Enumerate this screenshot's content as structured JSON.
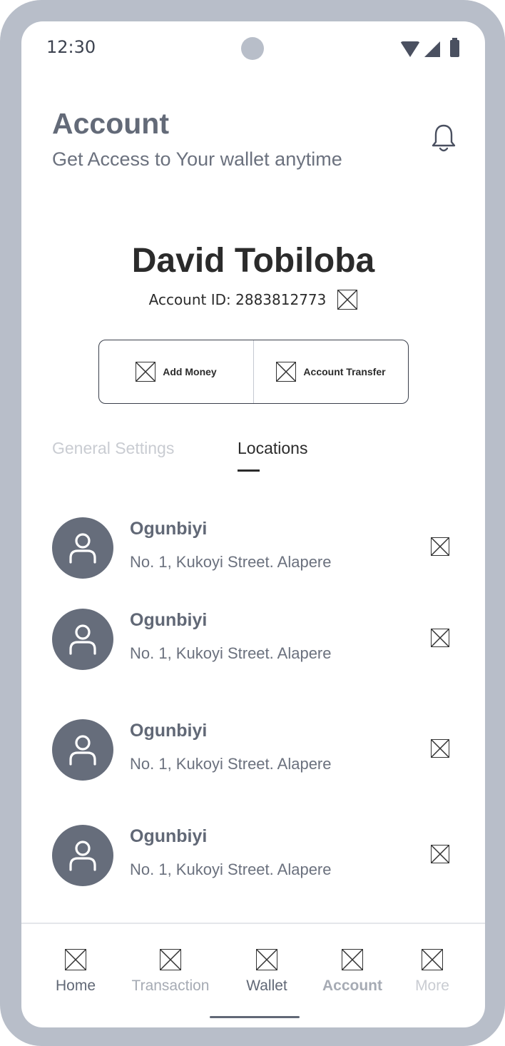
{
  "status_bar": {
    "time": "12:30"
  },
  "header": {
    "title": "Account",
    "subtitle": "Get Access to Your wallet anytime"
  },
  "profile": {
    "name": "David Tobiloba",
    "account_id": "Account  ID: 2883812773"
  },
  "actions": {
    "add_money": "Add Money",
    "account_transfer": "Account Transfer"
  },
  "tabs": {
    "general": "General Settings",
    "locations": "Locations",
    "active": "Locations"
  },
  "locations": [
    {
      "name": "Ogunbiyi",
      "address": "No. 1, Kukoyi Street. Alapere"
    },
    {
      "name": "Ogunbiyi",
      "address": "No. 1, Kukoyi Street. Alapere"
    },
    {
      "name": "Ogunbiyi",
      "address": "No. 1, Kukoyi Street. Alapere"
    },
    {
      "name": "Ogunbiyi",
      "address": "No. 1, Kukoyi Street. Alapere"
    }
  ],
  "nav": {
    "home": "Home",
    "transaction": "Transaction",
    "wallet": "Wallet",
    "account": "Account",
    "more": "More"
  },
  "colors": {
    "frame": "#b8bec9",
    "avatar": "#666d7b",
    "text_dark": "#2b2b2b",
    "text_muted": "#616876"
  }
}
